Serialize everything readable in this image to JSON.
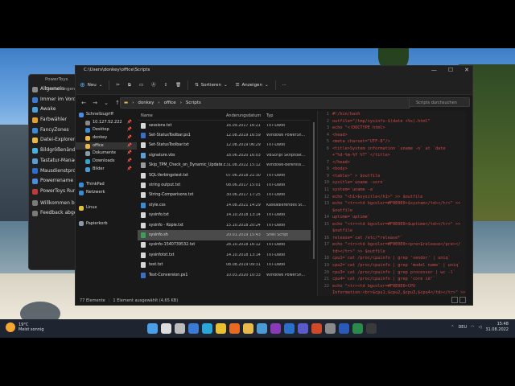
{
  "powertoys": {
    "title": "PowerToys Einstellungen",
    "items": [
      {
        "label": "Allgemein",
        "icon": "gear-icon",
        "color": "#8a8a8a"
      },
      {
        "label": "Immer im Vordergrund",
        "icon": "pin-window-icon",
        "color": "#3a7bd5"
      },
      {
        "label": "Awake",
        "icon": "coffee-icon",
        "color": "#4aa0d8"
      },
      {
        "label": "Farbwähler",
        "icon": "color-picker-icon",
        "color": "#e0a030"
      },
      {
        "label": "FancyZones",
        "icon": "zones-icon",
        "color": "#3a8ad5"
      },
      {
        "label": "Datei-Explorer",
        "icon": "folder-preview-icon",
        "color": "#e8b84a"
      },
      {
        "label": "Bildgrößenänderung",
        "icon": "image-resize-icon",
        "color": "#4ab0e0"
      },
      {
        "label": "Tastatur-Manager",
        "icon": "keyboard-icon",
        "color": "#5a9ad5"
      },
      {
        "label": "Mausdienstprogramme",
        "icon": "mouse-icon",
        "color": "#2d6fd0"
      },
      {
        "label": "Powerrename",
        "icon": "rename-icon",
        "color": "#4a8de0"
      },
      {
        "label": "PowerToys Run",
        "icon": "run-icon",
        "color": "#c03a3a"
      },
      {
        "label": "Willkommen bei PowerToys",
        "icon": "welcome-icon",
        "color": "#7a7a7a"
      },
      {
        "label": "Feedback abgeben",
        "icon": "feedback-icon",
        "color": "#7a7a7a"
      }
    ]
  },
  "explorer": {
    "title": "C:\\Users\\donkey\\office\\Scripts",
    "toolbar": {
      "new_label": "Neu",
      "sort_label": "Sortieren",
      "view_label": "Anzeigen",
      "more_label": "···"
    },
    "breadcrumb": [
      "donkey",
      "office",
      "Scripts"
    ],
    "search_placeholder": "Scripts durchsuchen",
    "nav": [
      {
        "label": "Schnellzugriff",
        "icon": "star-icon",
        "color": "#4a8de0",
        "pinned": false,
        "selected": false
      },
      {
        "label": "10.127.52.222",
        "icon": "network-drive-icon",
        "color": "#888888",
        "pinned": true,
        "selected": false
      },
      {
        "label": "Desktop",
        "icon": "desktop-icon",
        "color": "#3a8ad5",
        "pinned": true,
        "selected": false
      },
      {
        "label": "donkey",
        "icon": "folder-icon",
        "color": "#e8b84a",
        "pinned": true,
        "selected": false
      },
      {
        "label": "office",
        "icon": "folder-icon",
        "color": "#e8b84a",
        "pinned": true,
        "selected": true
      },
      {
        "label": "Dokumente",
        "icon": "documents-icon",
        "color": "#8a9aaa",
        "pinned": true,
        "selected": false
      },
      {
        "label": "Downloads",
        "icon": "download-icon",
        "color": "#3aa0c8",
        "pinned": true,
        "selected": false
      },
      {
        "label": "Bilder",
        "icon": "pictures-icon",
        "color": "#4a9ad5",
        "pinned": true,
        "selected": false
      },
      {
        "label": "",
        "icon": "",
        "color": "",
        "pinned": false,
        "selected": false
      },
      {
        "label": "ThinkPad",
        "icon": "pc-icon",
        "color": "#3a8ad5",
        "pinned": false,
        "selected": false
      },
      {
        "label": "Netzwerk",
        "icon": "network-icon",
        "color": "#3a8ad5",
        "pinned": false,
        "selected": false
      },
      {
        "label": "",
        "icon": "",
        "color": "",
        "pinned": false,
        "selected": false
      },
      {
        "label": "Linux",
        "icon": "linux-icon",
        "color": "#e0c040",
        "pinned": false,
        "selected": false
      },
      {
        "label": "",
        "icon": "",
        "color": "",
        "pinned": false,
        "selected": false
      },
      {
        "label": "Papierkorb",
        "icon": "recycle-bin-icon",
        "color": "#8a9aaa",
        "pinned": false,
        "selected": false
      }
    ],
    "columns": {
      "name": "Name",
      "date": "Änderungsdatum",
      "type": "Typ"
    },
    "files": [
      {
        "name": "sessions.txt",
        "date": "16.09.2017 16:21",
        "type": "TXT-Datei",
        "color": "#d8d8d8",
        "selected": false
      },
      {
        "name": "Set-StatusToolbar.ps1",
        "date": "12.08.2019 16:59",
        "type": "Windows PowerSh...",
        "color": "#3a6fc8",
        "selected": false
      },
      {
        "name": "Set-StatusToolbar.txt",
        "date": "12.08.2019 06:29",
        "type": "TXT-Datei",
        "color": "#d8d8d8",
        "selected": false
      },
      {
        "name": "signature.vbs",
        "date": "18.06.2020 16:03",
        "type": "VBScript Skriptdat...",
        "color": "#5aa0d8",
        "selected": false
      },
      {
        "name": "Skip_TPM_Check_on_Dynamic_Update.cmd",
        "date": "31.08.2022 15:12",
        "type": "Windows-Befehlss...",
        "color": "#9a9a9a",
        "selected": false
      },
      {
        "name": "SQL-Verbingstest.txt",
        "date": "07.06.2018 21:30",
        "type": "TXT-Datei",
        "color": "#d8d8d8",
        "selected": false
      },
      {
        "name": "string output.txt",
        "date": "08.06.2017 15:01",
        "type": "TXT-Datei",
        "color": "#d8d8d8",
        "selected": false
      },
      {
        "name": "String-Comparisons.txt",
        "date": "30.06.2017 17:25",
        "type": "TXT-Datei",
        "color": "#d8d8d8",
        "selected": false
      },
      {
        "name": "style.css",
        "date": "14.08.2021 14:29",
        "type": "Kaskadierendes St...",
        "color": "#3a8ad5",
        "selected": false
      },
      {
        "name": "sysinfo.txt",
        "date": "14.10.2018 13:14",
        "type": "TXT-Datei",
        "color": "#d8d8d8",
        "selected": false
      },
      {
        "name": "sysinfo - Kopie.txt",
        "date": "15.10.2018 20:24",
        "type": "TXT-Datei",
        "color": "#d8d8d8",
        "selected": false
      },
      {
        "name": "sysinfo.sh",
        "date": "20.01.2019 15:43",
        "type": "Shell Script",
        "color": "#3aa05a",
        "selected": true
      },
      {
        "name": "sysinfo-1540739532.txt",
        "date": "28.10.2018 16:12",
        "type": "TXT-Datei",
        "color": "#d8d8d8",
        "selected": false
      },
      {
        "name": "sysinfotxt.txt",
        "date": "14.10.2018 13:14",
        "type": "TXT-Datei",
        "color": "#d8d8d8",
        "selected": false
      },
      {
        "name": "test.txt",
        "date": "08.08.2019 09:31",
        "type": "TXT-Datei",
        "color": "#d8d8d8",
        "selected": false
      },
      {
        "name": "Text-Conversion.ps1",
        "date": "10.03.2020 10:33",
        "type": "Windows PowerSh...",
        "color": "#3a6fc8",
        "selected": false
      }
    ],
    "code_start_line": 1,
    "code": [
      "#!/bin/bash",
      "outfile=\"/tmp/sysinfo-$(date +%s).html\"",
      "echo \"<!DOCTYPE html>",
      "<head>",
      "<meta charset=\"UTF-8\"/>",
      "<title>System information `uname -n` at `date",
      "+\"%d-%m-%Y %T\"`</title>",
      "</head>",
      "<body>",
      "<table>\" > $outfile",
      "sysitle=`uname -sorn`",
      "system=`uname -a`",
      "echo \"<h1>$sysitle</h1>\" >> $outfile",
      "echo \"<tr><td bgcolor=#F0E0E0>$system</td></tr>\" >>",
      "$outfile",
      "uptime=`uptime`",
      "echo \"<tr><td bgcolor=#F0E0E0>$uptime</td></tr>\" >>",
      "$outfile",
      "release=`cat /etc/*release*`",
      "echo \"<tr><td bgcolor=#F0E0E0><pre>$release</pre></",
      "td></tr>\" >> $outfile",
      "cpu1=`cat /proc/cpuinfo | grep 'vendor' | uniq`",
      "cpu2=`cat /proc/cpuinfo | grep 'model name' | uniq`",
      "cpu3=`cat /proc/cpuinfo | grep processor | wc -l`",
      "cpu4=`cat /proc/cpuinfo | grep 'core id'`",
      "echo \"<tr><td bgcolor=#F0E0E0>CPU",
      "Information:<br>$cpu1,$cpu2,$cpu3,$cpu4</td></tr>\" >>",
      "$outfile",
      "free=`free -m`"
    ],
    "code_line_numbers": [
      "1",
      "2",
      "3",
      "4",
      "5",
      "6",
      "",
      "7",
      "8",
      "9",
      "10",
      "11",
      "12",
      "13",
      "",
      "14",
      "15",
      "",
      "16",
      "17",
      "",
      "18",
      "19",
      "20",
      "21",
      "22",
      "",
      "",
      "23"
    ],
    "status": {
      "count": "77 Elemente",
      "selection": "1 Element ausgewählt (4,65 KB)"
    }
  },
  "taskbar": {
    "weather_temp": "19°C",
    "weather_desc": "Meist sonnig",
    "apps": [
      {
        "name": "start-icon",
        "color": "#4aa0e8"
      },
      {
        "name": "search-icon",
        "color": "#dddddd"
      },
      {
        "name": "task-view-icon",
        "color": "#bbbbbb"
      },
      {
        "name": "widgets-icon",
        "color": "#3a7bd5"
      },
      {
        "name": "edge-icon",
        "color": "#2aa6d8"
      },
      {
        "name": "chrome-icon",
        "color": "#e8c030"
      },
      {
        "name": "firefox-icon",
        "color": "#e86a20"
      },
      {
        "name": "file-explorer-icon",
        "color": "#e8b84a"
      },
      {
        "name": "store-icon",
        "color": "#4a9ad5"
      },
      {
        "name": "onenote-icon",
        "color": "#8a3ab8"
      },
      {
        "name": "outlook-icon",
        "color": "#2a6fc8"
      },
      {
        "name": "teams-icon",
        "color": "#5a5ac8"
      },
      {
        "name": "powerpoint-icon",
        "color": "#d04a2a"
      },
      {
        "name": "settings-icon",
        "color": "#8a8a8a"
      },
      {
        "name": "word-icon",
        "color": "#2a5ab8"
      },
      {
        "name": "excel-icon",
        "color": "#2a8a4a"
      },
      {
        "name": "terminal-icon",
        "color": "#3a3a3a"
      }
    ],
    "lang": "DEU",
    "time": "15:48",
    "date": "31.08.2022"
  }
}
